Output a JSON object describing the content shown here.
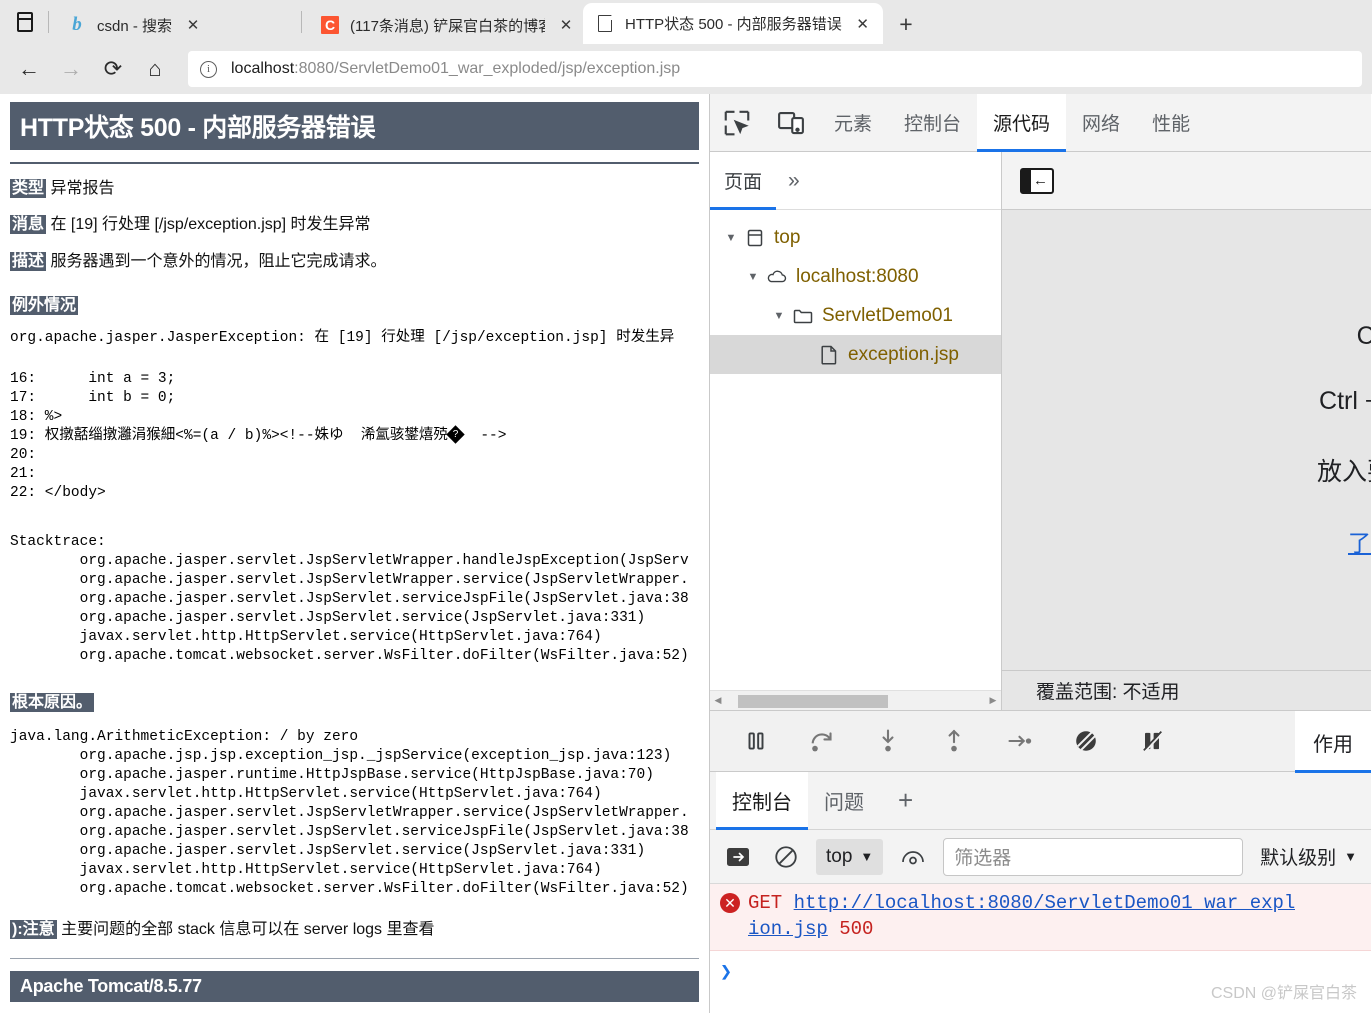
{
  "browser": {
    "tabs": [
      {
        "title": "csdn - 搜索",
        "favicon": "bing-icon",
        "active": false
      },
      {
        "title": "(117条消息) 铲屎官白茶的博客_C",
        "favicon": "csdn-icon",
        "active": false
      },
      {
        "title": "HTTP状态 500 - 内部服务器错误",
        "favicon": "document-icon",
        "active": true
      }
    ],
    "new_tab_label": "+",
    "close_label": "✕",
    "nav": {
      "back": "←",
      "forward": "→",
      "reload": "⟳",
      "home": "⌂"
    },
    "omnibox": {
      "info_glyph": "ⓘ",
      "host": "localhost",
      "path": ":8080/ServletDemo01_war_exploded/jsp/exception.jsp"
    }
  },
  "error_page": {
    "title": "HTTP状态 500 - 内部服务器错误",
    "fields": [
      {
        "tag": "类型",
        "value": " 异常报告"
      },
      {
        "tag": "消息",
        "value": " 在 [19] 行处理 [/jsp/exception.jsp] 时发生异常"
      },
      {
        "tag": "描述",
        "value": " 服务器遇到一个意外的情况，阻止它完成请求。"
      }
    ],
    "exception_heading": "例外情况",
    "exception_first_line": "org.apache.jasper.JasperException: 在 [19] 行处理 [/jsp/exception.jsp] 时发生异",
    "source_lines": [
      "16:      int a = 3;",
      "17:      int b = 0;",
      "18: %>",
      "20:",
      "21:",
      "22: </body>"
    ],
    "mojibake_line_prefix": "19: 权撴嚭缁撴灉涓猴細<%=(a / b)%><!--姝ゆ  浠氳骇鐢熺殑",
    "mojibake_line_suffix": "  -->",
    "stacktrace_heading": "Stacktrace:",
    "stacktrace_lines": [
      "        org.apache.jasper.servlet.JspServletWrapper.handleJspException(JspServ",
      "        org.apache.jasper.servlet.JspServletWrapper.service(JspServletWrapper.",
      "        org.apache.jasper.servlet.JspServlet.serviceJspFile(JspServlet.java:38",
      "        org.apache.jasper.servlet.JspServlet.service(JspServlet.java:331)",
      "        javax.servlet.http.HttpServlet.service(HttpServlet.java:764)",
      "        org.apache.tomcat.websocket.server.WsFilter.doFilter(WsFilter.java:52)"
    ],
    "root_cause_heading": "根本原因。",
    "root_cause_lines": [
      "java.lang.ArithmeticException: / by zero",
      "        org.apache.jsp.jsp.exception_jsp._jspService(exception_jsp.java:123)",
      "        org.apache.jasper.runtime.HttpJspBase.service(HttpJspBase.java:70)",
      "        javax.servlet.http.HttpServlet.service(HttpServlet.java:764)",
      "        org.apache.jasper.servlet.JspServletWrapper.service(JspServletWrapper.",
      "        org.apache.jasper.servlet.JspServlet.serviceJspFile(JspServlet.java:38",
      "        org.apache.jasper.servlet.JspServlet.service(JspServlet.java:331)",
      "        javax.servlet.http.HttpServlet.service(HttpServlet.java:764)",
      "        org.apache.tomcat.websocket.server.WsFilter.doFilter(WsFilter.java:52)"
    ],
    "note_tag": "):注意",
    "note_text": " 主要问题的全部 stack 信息可以在 server logs 里查看",
    "footer": "Apache Tomcat/8.5.77",
    "banner_color": "#525d6d"
  },
  "devtools": {
    "main_tabs": [
      {
        "label": "元素",
        "active": false
      },
      {
        "label": "控制台",
        "active": false
      },
      {
        "label": "源代码",
        "active": true
      },
      {
        "label": "网络",
        "active": false
      },
      {
        "label": "性能",
        "active": false
      }
    ],
    "icons": {
      "inspect": "inspect-element-icon",
      "device": "device-toolbar-icon"
    },
    "navigator": {
      "subtabs": [
        {
          "label": "页面",
          "active": true
        }
      ],
      "more_label": "»",
      "tree": [
        {
          "label": "top",
          "icon": "frame-icon",
          "depth": 0,
          "caret": "▼",
          "selected": false
        },
        {
          "label": "localhost:8080",
          "icon": "cloud-icon",
          "depth": 1,
          "caret": "▼",
          "selected": false
        },
        {
          "label": "ServletDemo01",
          "icon": "folder-icon",
          "depth": 2,
          "caret": "▼",
          "selected": false
        },
        {
          "label": "exception.jsp",
          "icon": "file-icon",
          "depth": 3,
          "caret": "",
          "selected": true
        }
      ]
    },
    "editor": {
      "collapse_label": "←",
      "shortcut_lines": [
        "Ctrl +",
        "Ctrl + Sh",
        "放入要添",
        "了解关"
      ],
      "coverage_text": "覆盖范围: 不适用"
    },
    "debug_toolbar": {
      "buttons": [
        "pause-resume-icon",
        "step-over-icon",
        "step-into-icon",
        "step-out-icon",
        "step-icon",
        "deactivate-breakpoints-icon",
        "pause-on-exceptions-icon"
      ],
      "scope_tab_label": "作用"
    },
    "drawer": {
      "tabs": [
        {
          "label": "控制台",
          "active": true
        },
        {
          "label": "问题",
          "active": false
        }
      ],
      "plus_label": "+",
      "toolbar": {
        "sidebar_icon": "console-sidebar-icon",
        "clear_icon": "clear-console-icon",
        "context": "top",
        "caret": "▼",
        "eye_icon": "live-expression-icon",
        "filter_placeholder": "筛选器",
        "level": "默认级别",
        "level_caret": "▼"
      },
      "console_messages": [
        {
          "level": "error",
          "badge": "✕",
          "method": "GET",
          "url": "http://localhost:8080/ServletDemo01_war_expl",
          "url_wrap": "ion.jsp",
          "status": "500"
        }
      ],
      "prompt": "❯"
    }
  },
  "watermark": "CSDN @铲屎官白茶"
}
